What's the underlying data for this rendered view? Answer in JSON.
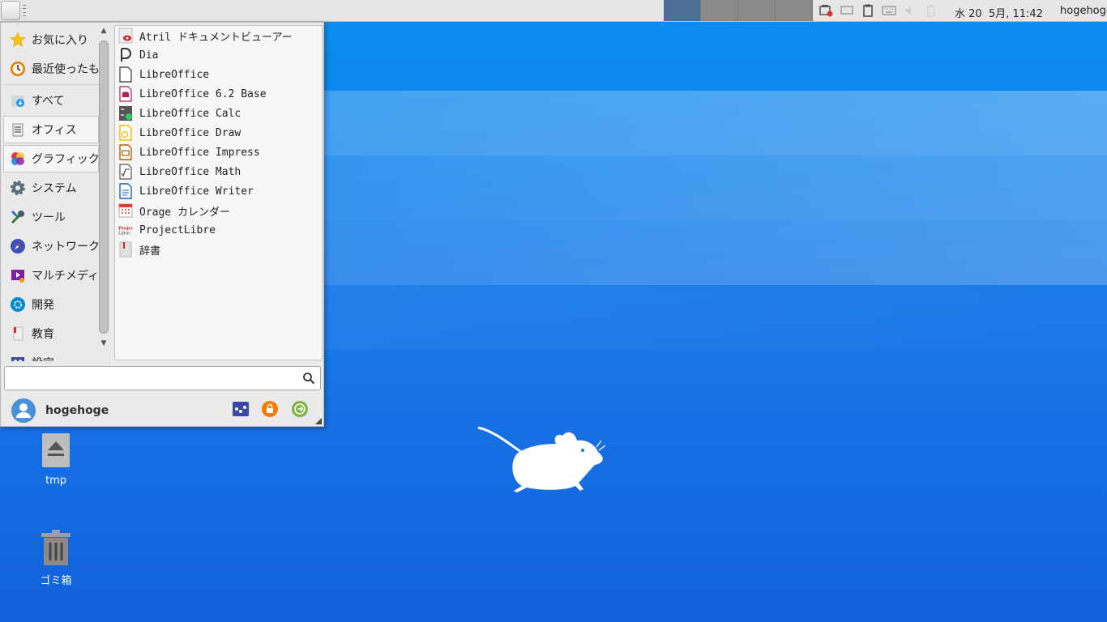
{
  "panel": {
    "clock": "水 20  5月, 11:42",
    "user": "hogehoge",
    "tray_icons": [
      "network-offline-icon",
      "display-icon",
      "clipboard-icon",
      "keyboard-icon",
      "volume-muted-icon",
      "battery-icon"
    ]
  },
  "menu": {
    "categories": [
      {
        "label": "お気に入り",
        "icon": "star-icon"
      },
      {
        "label": "最近使ったもの",
        "icon": "clock-icon"
      },
      {
        "label": "すべて",
        "icon": "download-icon"
      },
      {
        "label": "オフィス",
        "icon": "office-icon"
      },
      {
        "label": "グラフィック",
        "icon": "graphics-icon"
      },
      {
        "label": "システム",
        "icon": "gear-icon"
      },
      {
        "label": "ツール",
        "icon": "tools-icon"
      },
      {
        "label": "ネットワーク",
        "icon": "compass-icon"
      },
      {
        "label": "マルチメディア",
        "icon": "multimedia-icon"
      },
      {
        "label": "開発",
        "icon": "development-icon"
      },
      {
        "label": "教育",
        "icon": "education-icon"
      },
      {
        "label": "設定",
        "icon": "settings-icon"
      }
    ],
    "apps": [
      {
        "label": "Atril ドキュメントビューアー",
        "icon": "atril-icon"
      },
      {
        "label": "Dia",
        "icon": "dia-icon"
      },
      {
        "label": "LibreOffice",
        "icon": "libreoffice-icon"
      },
      {
        "label": "LibreOffice 6.2 Base",
        "icon": "libreoffice-base-icon"
      },
      {
        "label": "LibreOffice Calc",
        "icon": "libreoffice-calc-icon"
      },
      {
        "label": "LibreOffice Draw",
        "icon": "libreoffice-draw-icon"
      },
      {
        "label": "LibreOffice Impress",
        "icon": "libreoffice-impress-icon"
      },
      {
        "label": "LibreOffice Math",
        "icon": "libreoffice-math-icon"
      },
      {
        "label": "LibreOffice Writer",
        "icon": "libreoffice-writer-icon"
      },
      {
        "label": "Orage カレンダー",
        "icon": "calendar-icon"
      },
      {
        "label": "ProjectLibre",
        "icon": "projectlibre-icon"
      },
      {
        "label": "辞書",
        "icon": "dictionary-icon"
      }
    ],
    "search_placeholder": "",
    "username": "hogehoge",
    "projectlibre_logo_text": "Project Libre."
  },
  "desktop": {
    "icons": [
      {
        "label": "tmp",
        "icon": "eject-icon"
      },
      {
        "label": "ゴミ箱",
        "icon": "trash-icon"
      }
    ]
  },
  "colors": {
    "desktop_top": "#0a8ef0",
    "desktop_bottom": "#1160dc",
    "workspace_active": "#4d6f96"
  }
}
